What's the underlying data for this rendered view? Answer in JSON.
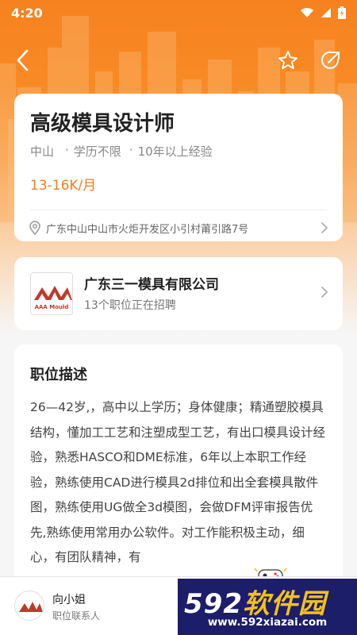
{
  "status_bar": {
    "time": "4:20",
    "icons": [
      "wifi-icon",
      "signal-icon",
      "battery-icon"
    ]
  },
  "top_bar": {
    "icons": [
      "back-arrow-icon",
      "star-icon",
      "share-icon"
    ]
  },
  "job": {
    "title": "高级模具设计师",
    "location": "中山",
    "separator": "·",
    "education": "学历不限",
    "experience": "10年以上经验",
    "salary": "13-16K/月",
    "address": "广东中山中山市火炬开发区小引村莆引路7号"
  },
  "company": {
    "name": "广东三一模具有限公司",
    "openings": "13个职位正在招聘",
    "logo_text": "AAA Mould"
  },
  "description": {
    "title": "职位描述",
    "body": "26—42岁,，高中以上学历；身体健康；精通塑胶模具结构，懂加工工艺和注塑成型工艺，有出口模具设计经验，熟悉HASCO和DME标准，6年以上本职工作经验，熟练使用CAD进行模具2d排位和出全套模具散件图，熟练使用UG做全3d模图，会做DFM评审报告优先,熟练使用常用办公软件。对工作能积极主动，细心，有团队精神，有"
  },
  "contact": {
    "name": "向小姐",
    "role": "职位联系人"
  },
  "watermark": {
    "digits": "592",
    "brand": "软件园",
    "url": "www.592xiazai.com"
  },
  "colors": {
    "accent": "#f57c1f",
    "header_orange": "#f6821f",
    "watermark_bg": "#1c1e6a",
    "watermark_yellow": "#f2c21b"
  }
}
